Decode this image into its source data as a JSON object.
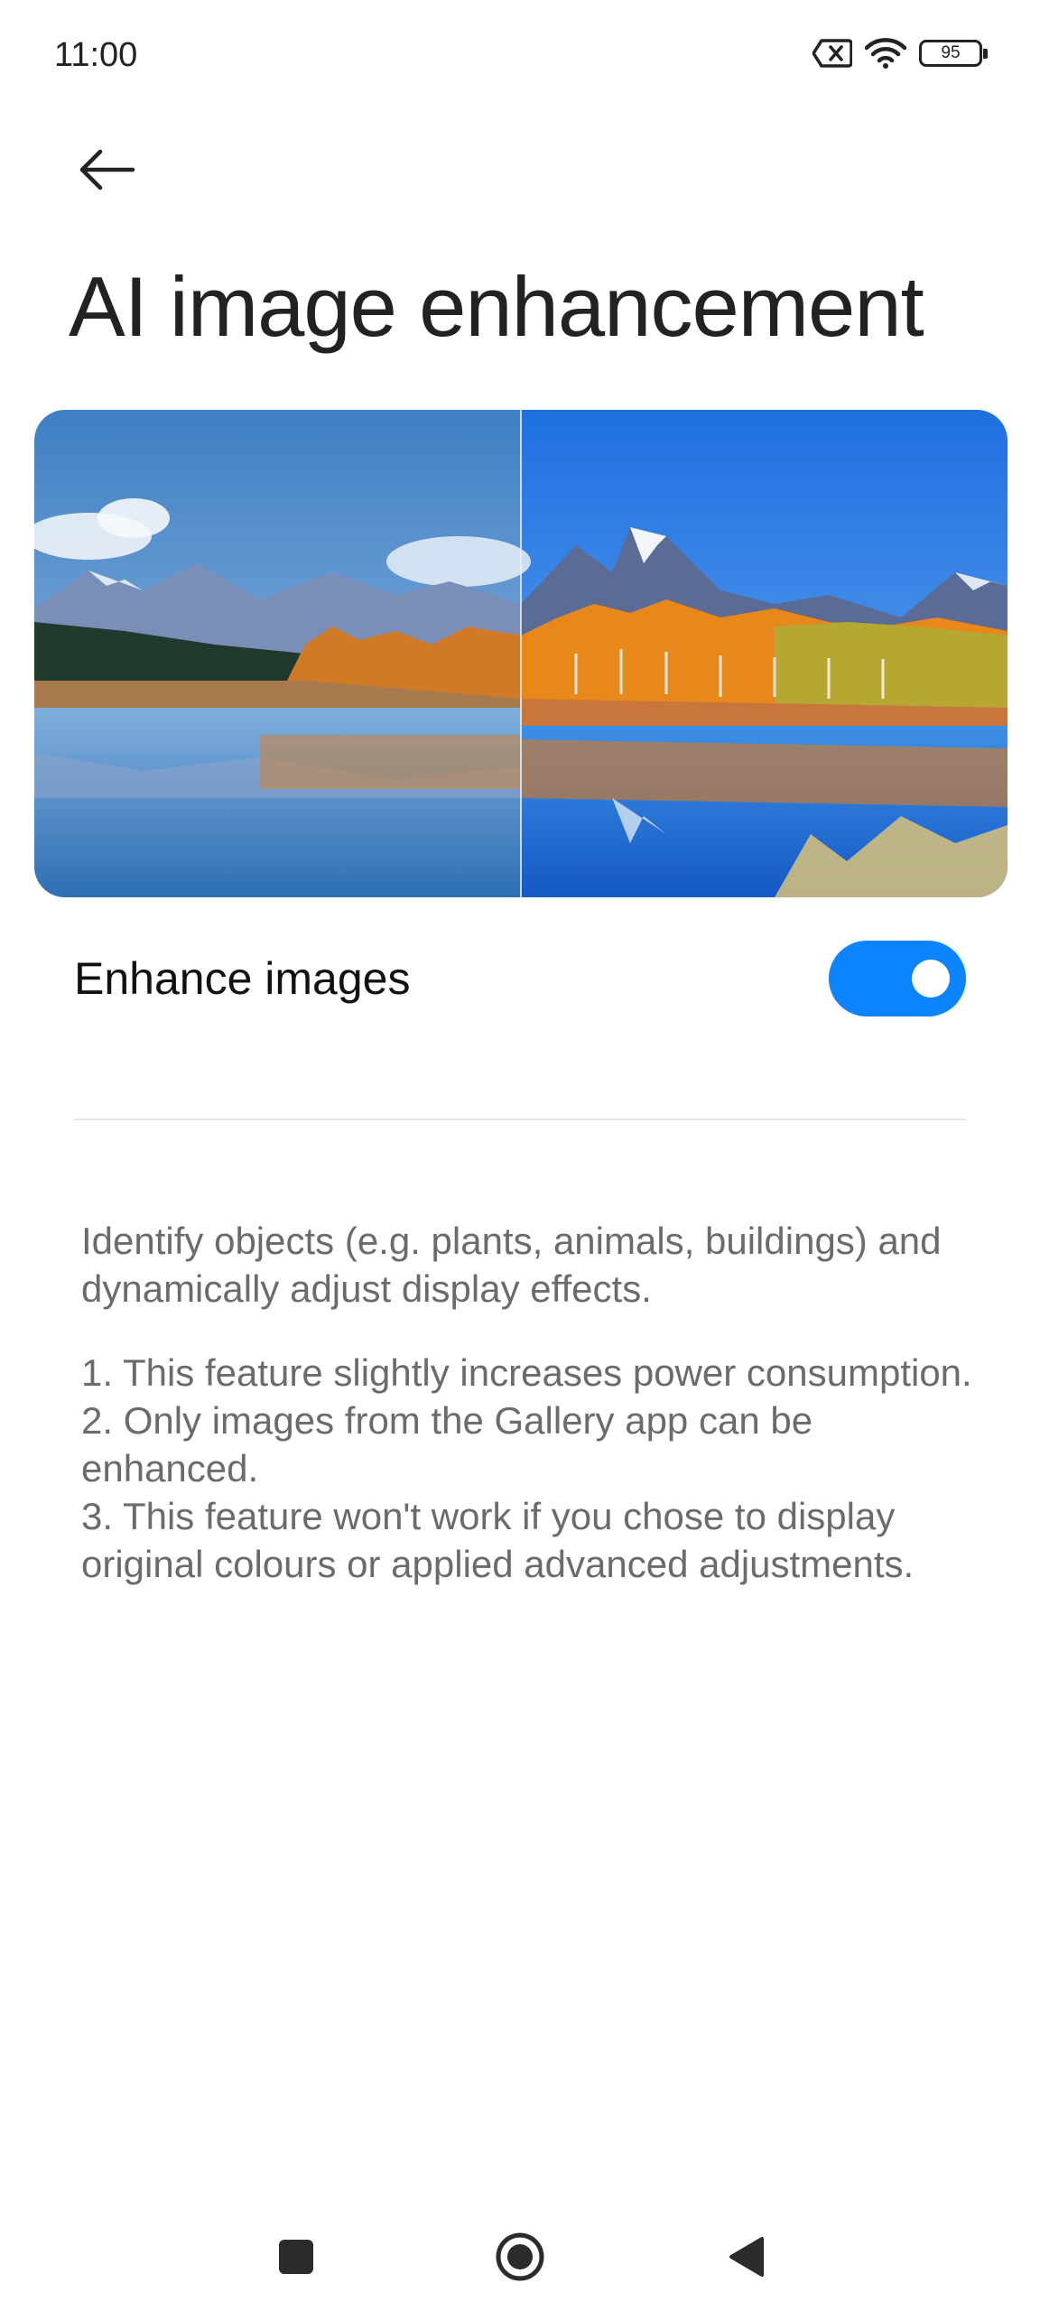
{
  "status_bar": {
    "time": "11:00",
    "battery_level": "95",
    "icons": [
      "sim-missing-icon",
      "wifi-icon",
      "battery-icon"
    ]
  },
  "header": {
    "back_icon": "arrow-left-icon",
    "title": "AI image enhancement"
  },
  "preview": {
    "description_icon": "before-after-landscape-image"
  },
  "setting": {
    "label": "Enhance images",
    "enabled": true,
    "accent_color": "#0d84ff"
  },
  "description": {
    "intro": "Identify objects (e.g. plants, animals, buildings) and dynamically adjust display effects.",
    "notes": [
      "1. This feature slightly increases power consumption.",
      "2. Only images from the Gallery app can be enhanced.",
      "3. This feature won't work if you chose to display original colours or applied advanced adjustments."
    ]
  },
  "nav_bar": {
    "icons": [
      "recents-square-icon",
      "home-circle-icon",
      "back-triangle-icon"
    ]
  }
}
